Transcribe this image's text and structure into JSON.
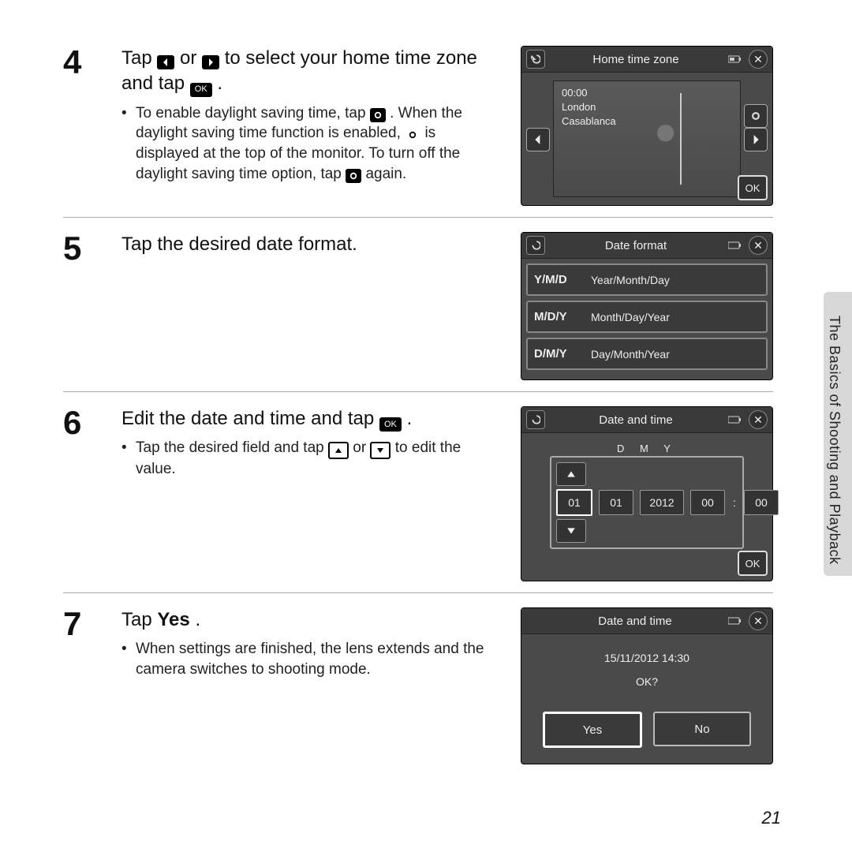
{
  "side_label": "The Basics of Shooting and Playback",
  "page_number": "21",
  "step4": {
    "num": "4",
    "headline_a": "Tap ",
    "headline_b": " or ",
    "headline_c": " to select your home time zone and tap ",
    "headline_d": ".",
    "ok_label": "OK",
    "bullet_a": "To enable daylight saving time, tap ",
    "bullet_b": ". When the daylight saving time function is enabled, ",
    "bullet_c": " is displayed at the top of the monitor. To turn off the daylight saving time option, tap ",
    "bullet_d": " again.",
    "screen_title": "Home time zone",
    "time": "00:00",
    "city1": "London",
    "city2": "Casablanca",
    "screen_ok": "OK"
  },
  "step5": {
    "num": "5",
    "headline": "Tap the desired date format.",
    "screen_title": "Date format",
    "rows": [
      {
        "k": "Y/M/D",
        "v": "Year/Month/Day"
      },
      {
        "k": "M/D/Y",
        "v": "Month/Day/Year"
      },
      {
        "k": "D/M/Y",
        "v": "Day/Month/Year"
      }
    ]
  },
  "step6": {
    "num": "6",
    "headline_a": "Edit the date and time and tap ",
    "headline_b": ".",
    "ok_label": "OK",
    "bullet_a": "Tap the desired field and tap ",
    "bullet_b": " or ",
    "bullet_c": " to edit the value.",
    "screen_title": "Date and time",
    "dmy": "D   M   Y",
    "day": "01",
    "month": "01",
    "year": "2012",
    "hour": "00",
    "min": "00",
    "screen_ok": "OK"
  },
  "step7": {
    "num": "7",
    "headline_a": "Tap ",
    "headline_yes": "Yes",
    "headline_b": ".",
    "bullet": "When settings are finished, the lens extends and the camera switches to shooting mode.",
    "screen_title": "Date and time",
    "datetime": "15/11/2012  14:30",
    "okq": "OK?",
    "yes": "Yes",
    "no": "No"
  }
}
